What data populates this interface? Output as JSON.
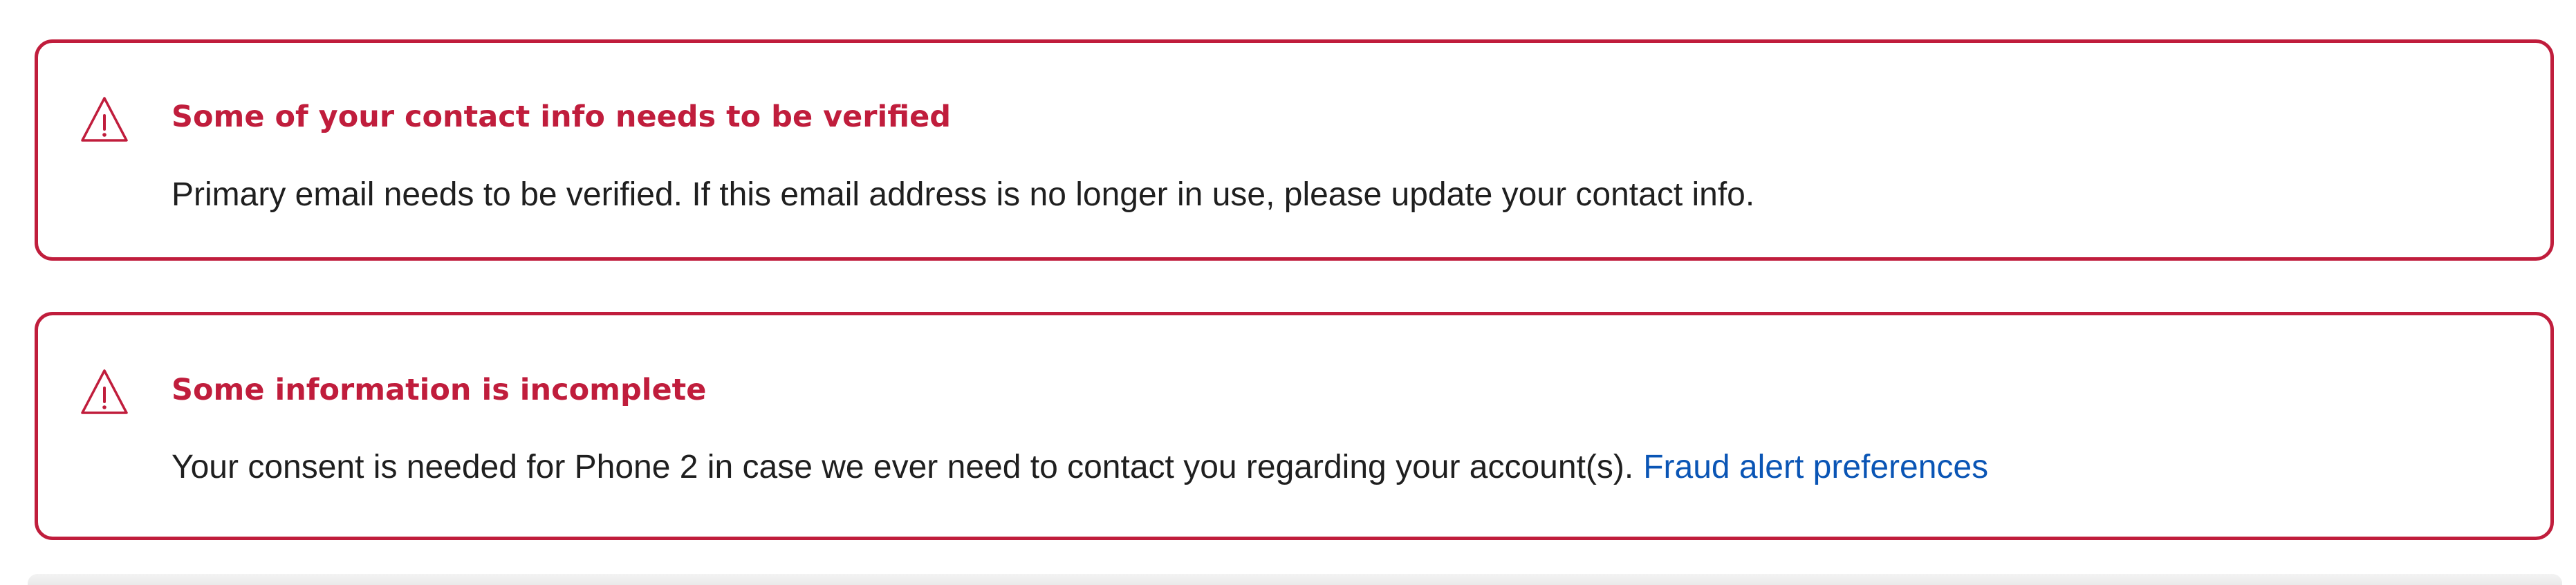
{
  "alerts": [
    {
      "icon": "warning-triangle-icon",
      "title": "Some of your contact info needs to be verified",
      "body": "Primary email needs to be verified. If this email address is no longer in use, please update your contact info."
    },
    {
      "icon": "warning-triangle-icon",
      "title": "Some information is incomplete",
      "body": "Your consent is needed for Phone 2 in case we ever need to contact you regarding your account(s).",
      "link": "Fraud alert preferences"
    }
  ],
  "colors": {
    "alert_red": "#c01d3c",
    "link_blue": "#0a55b5",
    "body_text": "#1f1f1f"
  }
}
